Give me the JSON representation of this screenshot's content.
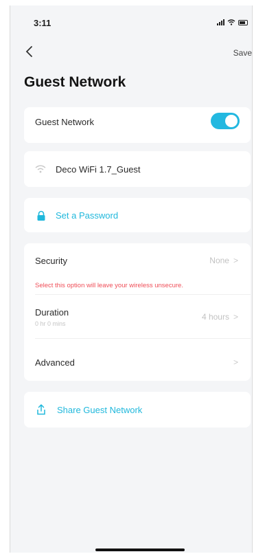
{
  "status_bar": {
    "time": "3:11"
  },
  "nav": {
    "save_label": "Save"
  },
  "page_title": "Guest Network",
  "guest_toggle": {
    "label": "Guest Network",
    "enabled": true
  },
  "wifi": {
    "ssid": "Deco WiFi 1.7_Guest"
  },
  "password": {
    "label": "Set a Password"
  },
  "security": {
    "label": "Security",
    "value": "None",
    "warning": "Select this option will leave your wireless unsecure."
  },
  "duration": {
    "label": "Duration",
    "sub_label": "0 hr 0 mins",
    "value": "4 hours"
  },
  "advanced": {
    "label": "Advanced"
  },
  "share": {
    "label": "Share Guest Network"
  },
  "colors": {
    "accent": "#20b8dc",
    "warning": "#ef4d57",
    "background": "#f4f5f7"
  }
}
